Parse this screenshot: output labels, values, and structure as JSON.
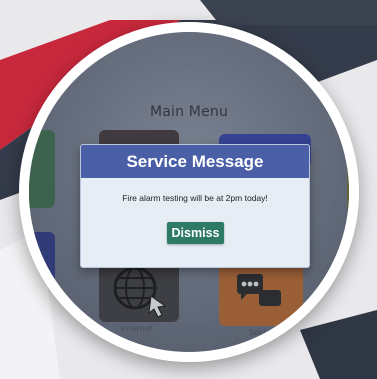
{
  "main_menu": {
    "title": "Main Menu",
    "tiles": [
      {
        "label": "Internet"
      },
      {
        "label": "Social"
      }
    ]
  },
  "dialog": {
    "title": "Service Message",
    "message": "Fire alarm testing will be at 2pm today!",
    "dismiss_label": "Dismiss"
  },
  "colors": {
    "dialog_header": "#4a5fa6",
    "dismiss_button": "#2e7a64",
    "accent_red": "#c8283c",
    "dark_band": "#343b4a"
  }
}
